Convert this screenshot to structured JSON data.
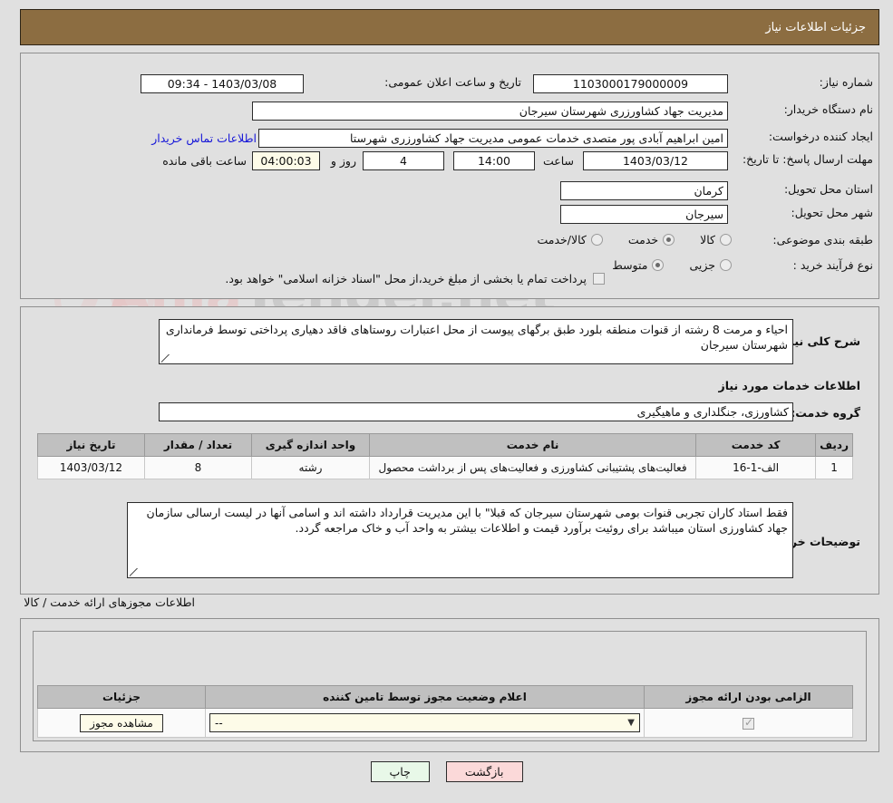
{
  "header": {
    "title": "جزئیات اطلاعات نیاز"
  },
  "watermark": {
    "text_left": "Ania",
    "text_right": "Tender.net"
  },
  "fields": {
    "need_number_label": "شماره نیاز:",
    "need_number_value": "1103000179000009",
    "public_announce_label": "تاریخ و ساعت اعلان عمومی:",
    "public_announce_value": "1403/03/08 - 09:34",
    "buyer_org_label": "نام دستگاه خریدار:",
    "buyer_org_value": "مدیریت جهاد کشاورزری شهرستان سیرجان",
    "requester_label": "ایجاد کننده درخواست:",
    "requester_value": "امین ابراهیم آبادی پور متصدی خدمات عمومی مدیریت جهاد کشاورزری شهرستا",
    "buyer_contact_link": "اطلاعات تماس خریدار",
    "deadline_label": "مهلت ارسال پاسخ: تا تاریخ:",
    "deadline_date": "1403/03/12",
    "deadline_hour_label": "ساعت",
    "deadline_hour": "14:00",
    "remaining_days": "4",
    "remaining_days_label": "روز و",
    "remaining_time": "04:00:03",
    "remaining_time_label": "ساعت باقی مانده",
    "province_label": "استان محل تحویل:",
    "province_value": "کرمان",
    "city_label": "شهر محل تحویل:",
    "city_value": "سیرجان",
    "category_label": "طبقه بندی موضوعی:",
    "category_options": [
      {
        "label": "کالا",
        "selected": false
      },
      {
        "label": "خدمت",
        "selected": true
      },
      {
        "label": "کالا/خدمت",
        "selected": false
      }
    ],
    "process_label": "نوع فرآیند خرید :",
    "process_options": [
      {
        "label": "جزیی",
        "selected": false
      },
      {
        "label": "متوسط",
        "selected": true
      }
    ],
    "treasury_checkbox_checked": false,
    "treasury_text": "پرداخت تمام یا بخشی از مبلغ خرید،از محل \"اسناد خزانه اسلامی\" خواهد بود."
  },
  "description": {
    "label": "شرح کلی نیاز:",
    "value": "احیاء و مرمت 8 رشته از قنوات منطقه بلورد طبق برگهای پیوست از محل اعتبارات روستاهای فاقد دهیاری پرداختی توسط فرمانداری شهرستان سیرجان"
  },
  "services": {
    "section_title": "اطلاعات خدمات مورد نیاز",
    "group_label": "گروه خدمت:",
    "group_value": "کشاورزی، جنگلداری و ماهیگیری",
    "columns": [
      "ردیف",
      "کد خدمت",
      "نام خدمت",
      "واحد اندازه گیری",
      "تعداد / مقدار",
      "تاریخ نیاز"
    ],
    "rows": [
      {
        "row": "1",
        "code": "الف-1-16",
        "name": "فعالیت‌های پشتیبانی کشاورزی و فعالیت‌های پس از برداشت محصول",
        "unit": "رشته",
        "quantity": "8",
        "need_date": "1403/03/12"
      }
    ]
  },
  "buyer_notes": {
    "label": "توضیحات خریدار:",
    "value": "فقط استاد کاران تجربی قنوات بومی شهرستان سیرجان که قبلا\" با این مدیریت قرارداد داشته اند و اسامی آنها در لیست ارسالی سازمان جهاد کشاورزی استان میباشد برای روئیت برآورد قیمت و اطلاعات بیشتر به واحد آب و خاک مراجعه گردد."
  },
  "permits": {
    "section_title": "اطلاعات مجوزهای ارائه خدمت / کالا",
    "columns": [
      "الزامی بودن ارائه مجوز",
      "اعلام وضعیت مجوز توسط تامین کننده",
      "جزئیات"
    ],
    "rows": [
      {
        "required_checked": true,
        "status_value": "--",
        "details_button": "مشاهده مجوز"
      }
    ]
  },
  "footer": {
    "print_label": "چاپ",
    "back_label": "بازگشت"
  },
  "colors": {
    "header_brown": "#8c6d41",
    "page_background": "#e0e0e0",
    "link_blue": "#1616d8",
    "table_header_gray": "#c0c0c0",
    "print_button_green": "#e8f8e8",
    "back_button_pink": "#fbd9d9",
    "cream_field": "#fdfbe8"
  }
}
